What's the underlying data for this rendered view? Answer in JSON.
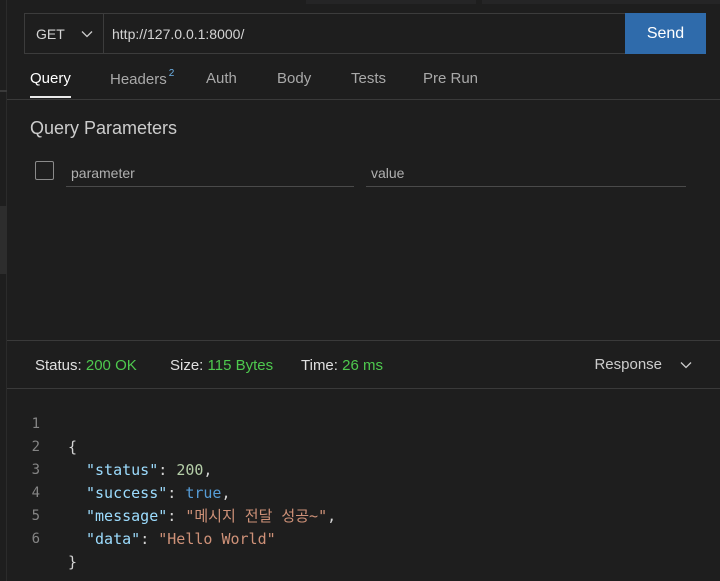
{
  "request": {
    "method": "GET",
    "url": "http://127.0.0.1:8000/",
    "send_label": "Send"
  },
  "tabs": [
    {
      "label": "Query",
      "active": true
    },
    {
      "label": "Headers",
      "badge": "2"
    },
    {
      "label": "Auth"
    },
    {
      "label": "Body"
    },
    {
      "label": "Tests"
    },
    {
      "label": "Pre Run"
    }
  ],
  "query": {
    "title": "Query Parameters",
    "param_placeholder": "parameter",
    "value_placeholder": "value"
  },
  "response": {
    "status_label": "Status:",
    "status_value": "200 OK",
    "size_label": "Size:",
    "size_value": "115 Bytes",
    "time_label": "Time:",
    "time_value": "26 ms",
    "view_select": "Response"
  },
  "code_lines": {
    "n1": "1",
    "n2": "2",
    "n3": "3",
    "n4": "4",
    "n5": "5",
    "n6": "6",
    "l1": "{",
    "l2_key": "\"status\"",
    "l2_val": "200",
    "l3_key": "\"success\"",
    "l3_val": "true",
    "l4_key": "\"message\"",
    "l4_val": "\"메시지 전달 성공~\"",
    "l5_key": "\"data\"",
    "l5_val": "\"Hello World\"",
    "l6": "}"
  },
  "colors": {
    "send_button": "#2f6bab",
    "status_ok": "#4ec94e",
    "json_key": "#9cdcfe",
    "json_string": "#ce9178",
    "json_number": "#b5cea8",
    "json_bool": "#569cd6"
  },
  "icons": {
    "method_dropdown": "chevron-down-icon",
    "response_dropdown": "chevron-down-icon"
  }
}
